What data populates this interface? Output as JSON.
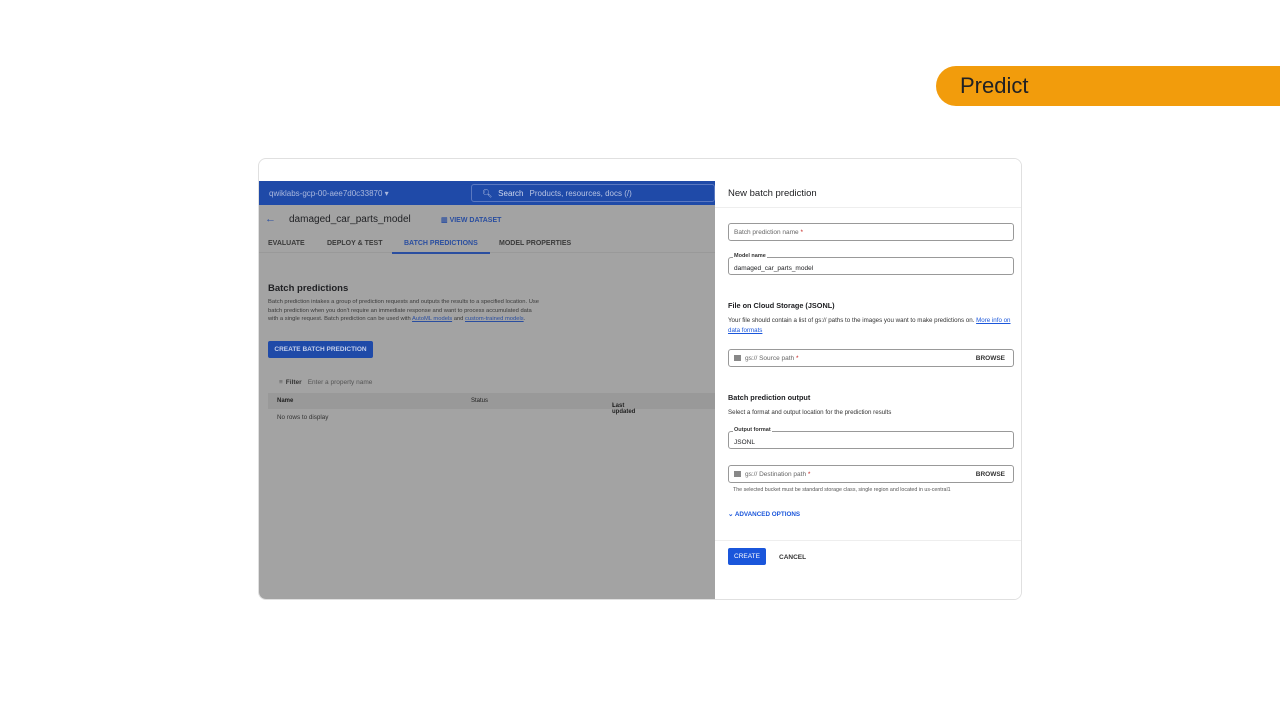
{
  "slide": {
    "title": "Predict",
    "accent": "#f29c0c"
  },
  "console": {
    "project": "qwiklabs-gcp-00-aee7d0c33870",
    "search_label": "Search",
    "search_placeholder": "Products, resources, docs (/)",
    "model_title": "damaged_car_parts_model",
    "view_dataset": "VIEW DATASET",
    "tabs": [
      {
        "label": "EVALUATE"
      },
      {
        "label": "DEPLOY & TEST"
      },
      {
        "label": "BATCH PREDICTIONS",
        "active": true
      },
      {
        "label": "MODEL PROPERTIES"
      }
    ],
    "section_title": "Batch predictions",
    "description": "Batch prediction intakes a group of prediction requests and outputs the results to a specified location. Use batch prediction when you don't require an immediate response and want to process accumulated data with a single request. Batch prediction can be used with ",
    "link_automl": "AutoML models",
    "and_text": " and ",
    "link_custom": "custom-trained models",
    "period": ".",
    "create_button": "CREATE BATCH PREDICTION",
    "filter_label": "Filter",
    "filter_placeholder": "Enter a property name",
    "columns": [
      "Name",
      "Status",
      "Last updated"
    ],
    "empty": "No rows to display"
  },
  "panel": {
    "title": "New batch prediction",
    "name_placeholder": "Batch prediction name",
    "required": "*",
    "model_label": "Model name",
    "model_value": "damaged_car_parts_model",
    "file_heading": "File on Cloud Storage (JSONL)",
    "file_text": "Your file should contain a list of gs:// paths to the images you want to make predictions on. ",
    "file_link": "More info on data formats",
    "source_placeholder": "gs:// Source path",
    "browse": "BROWSE",
    "output_heading": "Batch prediction output",
    "output_text": "Select a format and output location for the prediction results",
    "format_label": "Output format",
    "format_value": "JSONL",
    "dest_placeholder": "gs:// Destination path",
    "dest_hint": "The selected bucket must be standard storage class, single region and located in us-central1",
    "advanced": "ADVANCED OPTIONS",
    "create": "CREATE",
    "cancel": "CANCEL"
  }
}
